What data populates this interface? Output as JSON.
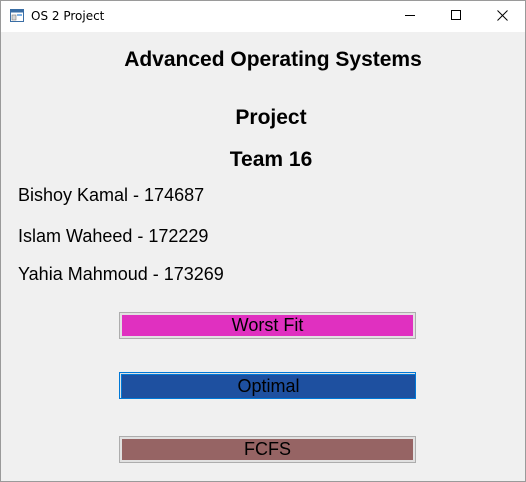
{
  "window": {
    "title": "OS 2 Project"
  },
  "icons": {
    "app": "app-window-icon",
    "minimize": "minimize-icon",
    "maximize": "maximize-icon",
    "close": "close-icon"
  },
  "content": {
    "heading": "Advanced Operating Systems",
    "project_label": "Project",
    "team_label": "Team 16",
    "members": [
      "Bishoy Kamal - 174687",
      "Islam Waheed - 172229",
      "Yahia Mahmoud - 173269"
    ]
  },
  "buttons": [
    {
      "label": "Worst Fit",
      "color": "#e030c0"
    },
    {
      "label": "Optimal",
      "color": "#1e50a0"
    },
    {
      "label": "FCFS",
      "color": "#966464"
    }
  ]
}
